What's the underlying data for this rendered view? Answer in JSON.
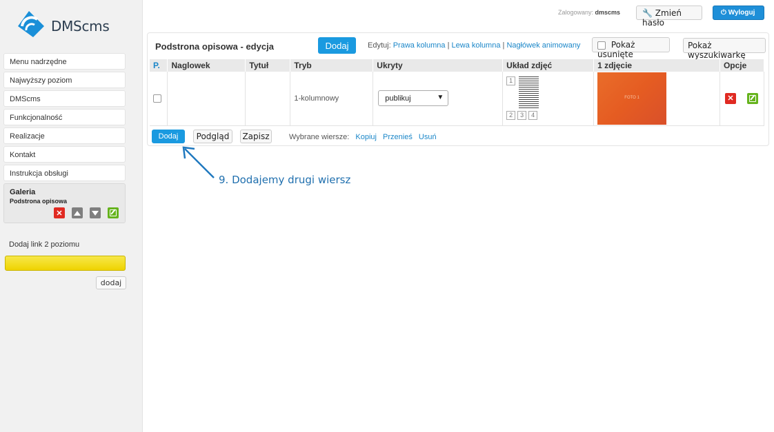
{
  "sidebar": {
    "logo_text": "DMScms",
    "menu": [
      "Menu nadrzędne",
      "Najwyższy poziom",
      "DMScms",
      "Funkcjonalność",
      "Realizacje",
      "Kontakt",
      "Instrukcja obsługi"
    ],
    "group": {
      "title": "Galeria",
      "subtitle": "Podstrona opisowa"
    },
    "addlink_label": "Dodaj link 2 poziomu",
    "addlink_button": "dodaj"
  },
  "topbar": {
    "logged_label": "Zalogowany:",
    "logged_user": "dmscms",
    "change_password": "Zmień hasło",
    "logout": "Wyloguj"
  },
  "panel": {
    "title": "Podstrona opisowa - edycja",
    "add_button": "Dodaj",
    "edit_label": "Edytuj:",
    "edit_links": [
      "Prawa kolumna",
      "Lewa kolumna",
      "Nagłówek animowany"
    ],
    "show_deleted": "Pokaż usunięte",
    "show_search": "Pokaż wyszukiwarkę",
    "columns": [
      "P.",
      "Naglowek",
      "Tytuł",
      "Tryb",
      "Ukryty",
      "Układ zdjęć",
      "1 zdjęcie",
      "Opcje"
    ],
    "row": {
      "mode": "1-kolumnowy",
      "visibility": "publikuj",
      "layout_boxes": [
        "1",
        "2",
        "3",
        "4"
      ],
      "photo_caption": "FOTO 1"
    },
    "footer": {
      "add": "Dodaj",
      "preview": "Podgląd",
      "save": "Zapisz",
      "selected_label": "Wybrane wiersze:",
      "actions": [
        "Kopiuj",
        "Przenieś",
        "Usuń"
      ]
    }
  },
  "annotation": "9. Dodajemy drugi wiersz",
  "colors": {
    "accent": "#1a9ae0",
    "delete": "#e02a22",
    "edit": "#65b31c",
    "highlight": "#f7e84a"
  }
}
